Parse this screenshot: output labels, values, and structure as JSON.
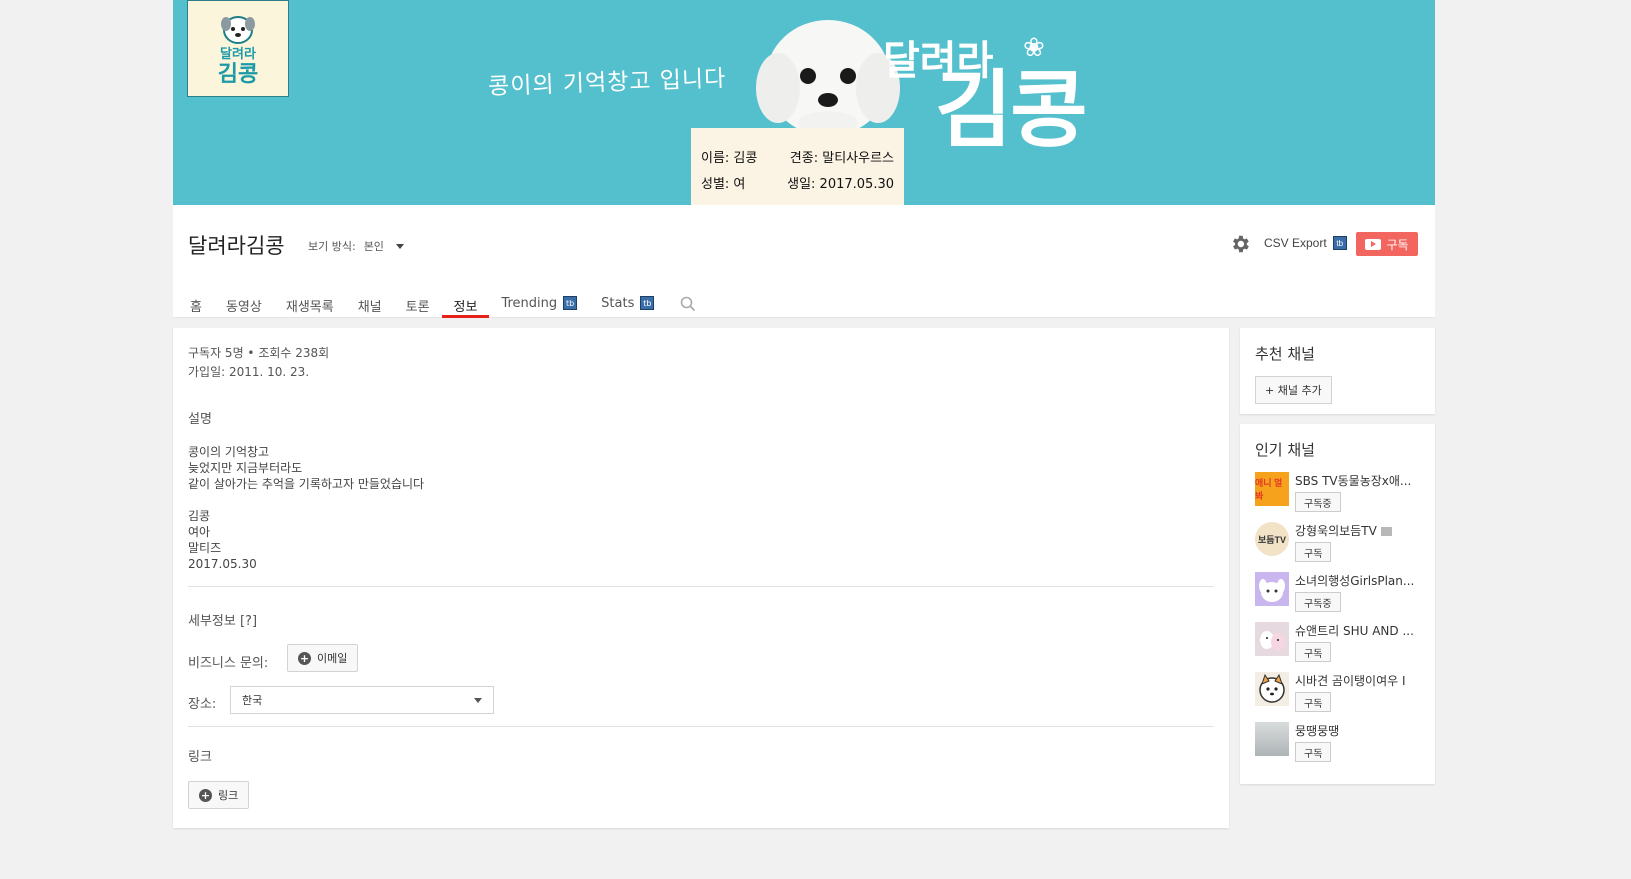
{
  "banner": {
    "logo_small": "달려라",
    "logo_big": "김콩",
    "tagline": "콩이의 기억창고 입니다",
    "sign_line1_left": "이름: 김콩",
    "sign_line1_right": "견종: 말티사우르스",
    "sign_line2_left": "성별: 여",
    "sign_line2_right": "생일: 2017.05.30",
    "title_small": "달려라",
    "title_big": "김콩"
  },
  "header": {
    "channel_name": "달려라김콩",
    "view_as_label": "보기 방식:",
    "view_as_value": "본인",
    "csv_export": "CSV Export",
    "badge": "tb",
    "subscribe": "구독"
  },
  "tabs": [
    {
      "label": "홈"
    },
    {
      "label": "동영상"
    },
    {
      "label": "재생목록"
    },
    {
      "label": "채널"
    },
    {
      "label": "토론"
    },
    {
      "label": "정보",
      "active": true
    },
    {
      "label": "Trending",
      "badge": true
    },
    {
      "label": "Stats",
      "badge": true
    }
  ],
  "about": {
    "stats": "구독자 5명 • 조회수 238회",
    "joined": "가입일: 2011. 10. 23.",
    "description_label": "설명",
    "description_lines": [
      "콩이의 기억창고",
      "늦었지만 지금부터라도",
      "같이 살아가는 추억을 기록하고자 만들었습니다"
    ],
    "info_lines": [
      "김콩",
      "여아",
      "말티즈",
      "2017.05.30"
    ],
    "details_label": "세부정보 [?]",
    "business_label": "비즈니스 문의:",
    "email_button": "이메일",
    "location_label": "장소:",
    "location_value": "한국",
    "links_label": "링크",
    "link_button": "링크"
  },
  "sidebar": {
    "recommended_title": "추천 채널",
    "add_channel": "+ 채널 추가",
    "popular_title": "인기 채널",
    "popular": [
      {
        "name": "SBS TV동물농장x애...",
        "button": "구독중",
        "thumb_text": "애니 멀봐",
        "thumb_color": "#f6a21c"
      },
      {
        "name": "강형욱의보듬TV",
        "button": "구독",
        "verified": true,
        "thumb_text": "보듬TV",
        "thumb_color": "#f2e3c7"
      },
      {
        "name": "소녀의행성GirlsPlan...",
        "button": "구독중",
        "thumb_text": "",
        "thumb_color": "#c9b6ee"
      },
      {
        "name": "슈앤트리 SHU AND ...",
        "button": "구독",
        "thumb_text": "",
        "thumb_color": "#e6d9df"
      },
      {
        "name": "시바견 곰이탱이여우 I",
        "button": "구독",
        "thumb_text": "",
        "thumb_color": "#f4ede4"
      },
      {
        "name": "뭉땡뭉땡",
        "button": "구독",
        "thumb_text": "",
        "thumb_color": "#c6cbcd"
      }
    ]
  },
  "colors": {
    "banner_bg": "#54c0cd",
    "subscribe_bg": "#f2665f",
    "active_tab": "#e62117"
  }
}
